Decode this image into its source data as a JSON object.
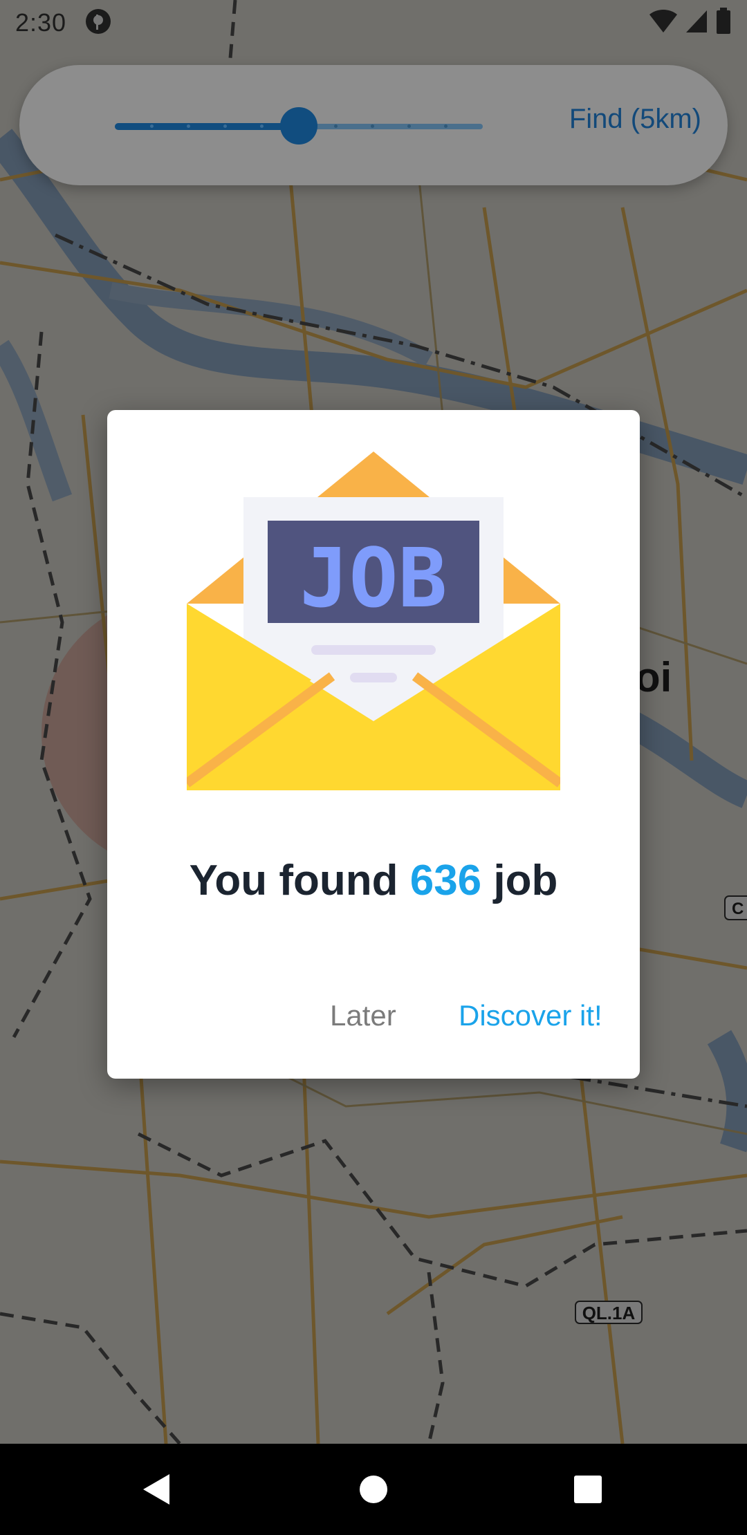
{
  "status_bar": {
    "time": "2:30",
    "icons": [
      "notification-app-icon",
      "wifi-icon",
      "cell-signal-icon",
      "battery-icon"
    ]
  },
  "range_card": {
    "slider": {
      "steps": 10,
      "selected_index": 5,
      "fraction": 0.5
    },
    "find_label": "Find (5km)"
  },
  "map": {
    "labels": [
      "QL.1A",
      "oi",
      "C"
    ]
  },
  "dialog": {
    "illustration": {
      "icon": "job-envelope-icon",
      "text": "JOB"
    },
    "headline_prefix": "You found ",
    "headline_count": "636",
    "headline_suffix": " job",
    "later_label": "Later",
    "discover_label": "Discover it!"
  },
  "nav_bar": {
    "items": [
      "back-icon",
      "home-icon",
      "recents-icon"
    ]
  },
  "colors": {
    "accent": "#1aa3ea",
    "slider": "#114d7f",
    "envelope_yellow": "#ffd830",
    "envelope_orange": "#f9b248",
    "job_card": "#50547f",
    "job_text": "#7f9cfb"
  }
}
